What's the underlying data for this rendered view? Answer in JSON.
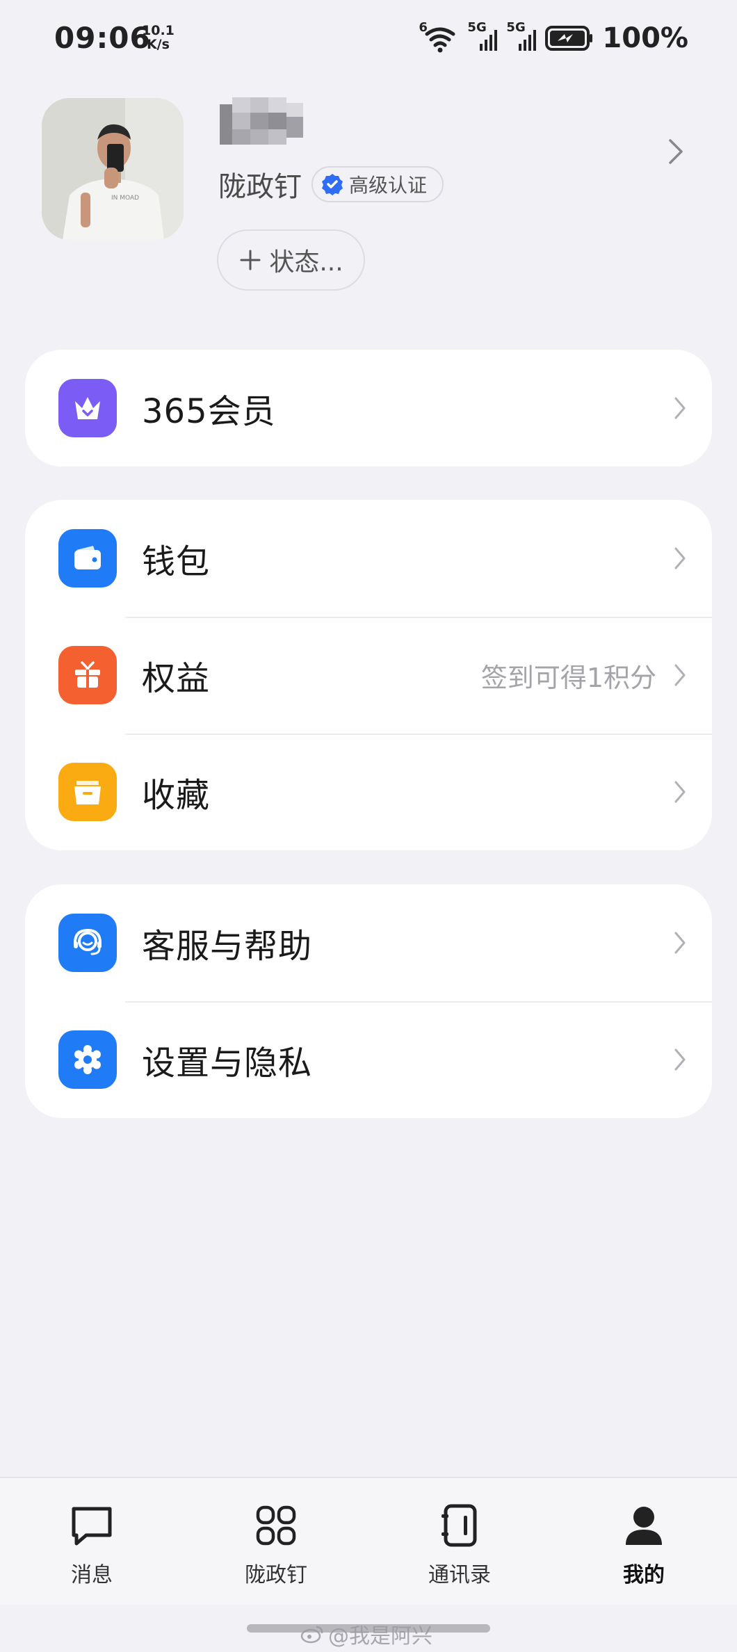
{
  "status_bar": {
    "time": "09:06",
    "net_speed_value": "10.1",
    "net_speed_unit": "K/s",
    "wifi_label": "6",
    "sim1_label": "5G",
    "sim2_label": "5G",
    "battery_percent": "100%"
  },
  "profile": {
    "org_name": "陇政钉",
    "cert_label": "高级认证",
    "status_button": "状态..."
  },
  "menu": {
    "membership": {
      "label": "365会员",
      "icon": "crown-icon",
      "color": "#7b5cf5"
    },
    "wallet": {
      "label": "钱包",
      "icon": "wallet-icon",
      "color": "#1f7cf6"
    },
    "benefits": {
      "label": "权益",
      "hint": "签到可得1积分",
      "icon": "gift-icon",
      "color": "#f4602f"
    },
    "favorites": {
      "label": "收藏",
      "icon": "folder-icon",
      "color": "#fbab12"
    },
    "support": {
      "label": "客服与帮助",
      "icon": "headset-icon",
      "color": "#1f7cf6"
    },
    "settings": {
      "label": "设置与隐私",
      "icon": "gear-icon",
      "color": "#1f7cf6"
    }
  },
  "tabs": {
    "messages": "消息",
    "workbench": "陇政钉",
    "contacts": "通讯录",
    "me": "我的"
  },
  "watermark": "@我是阿兴"
}
